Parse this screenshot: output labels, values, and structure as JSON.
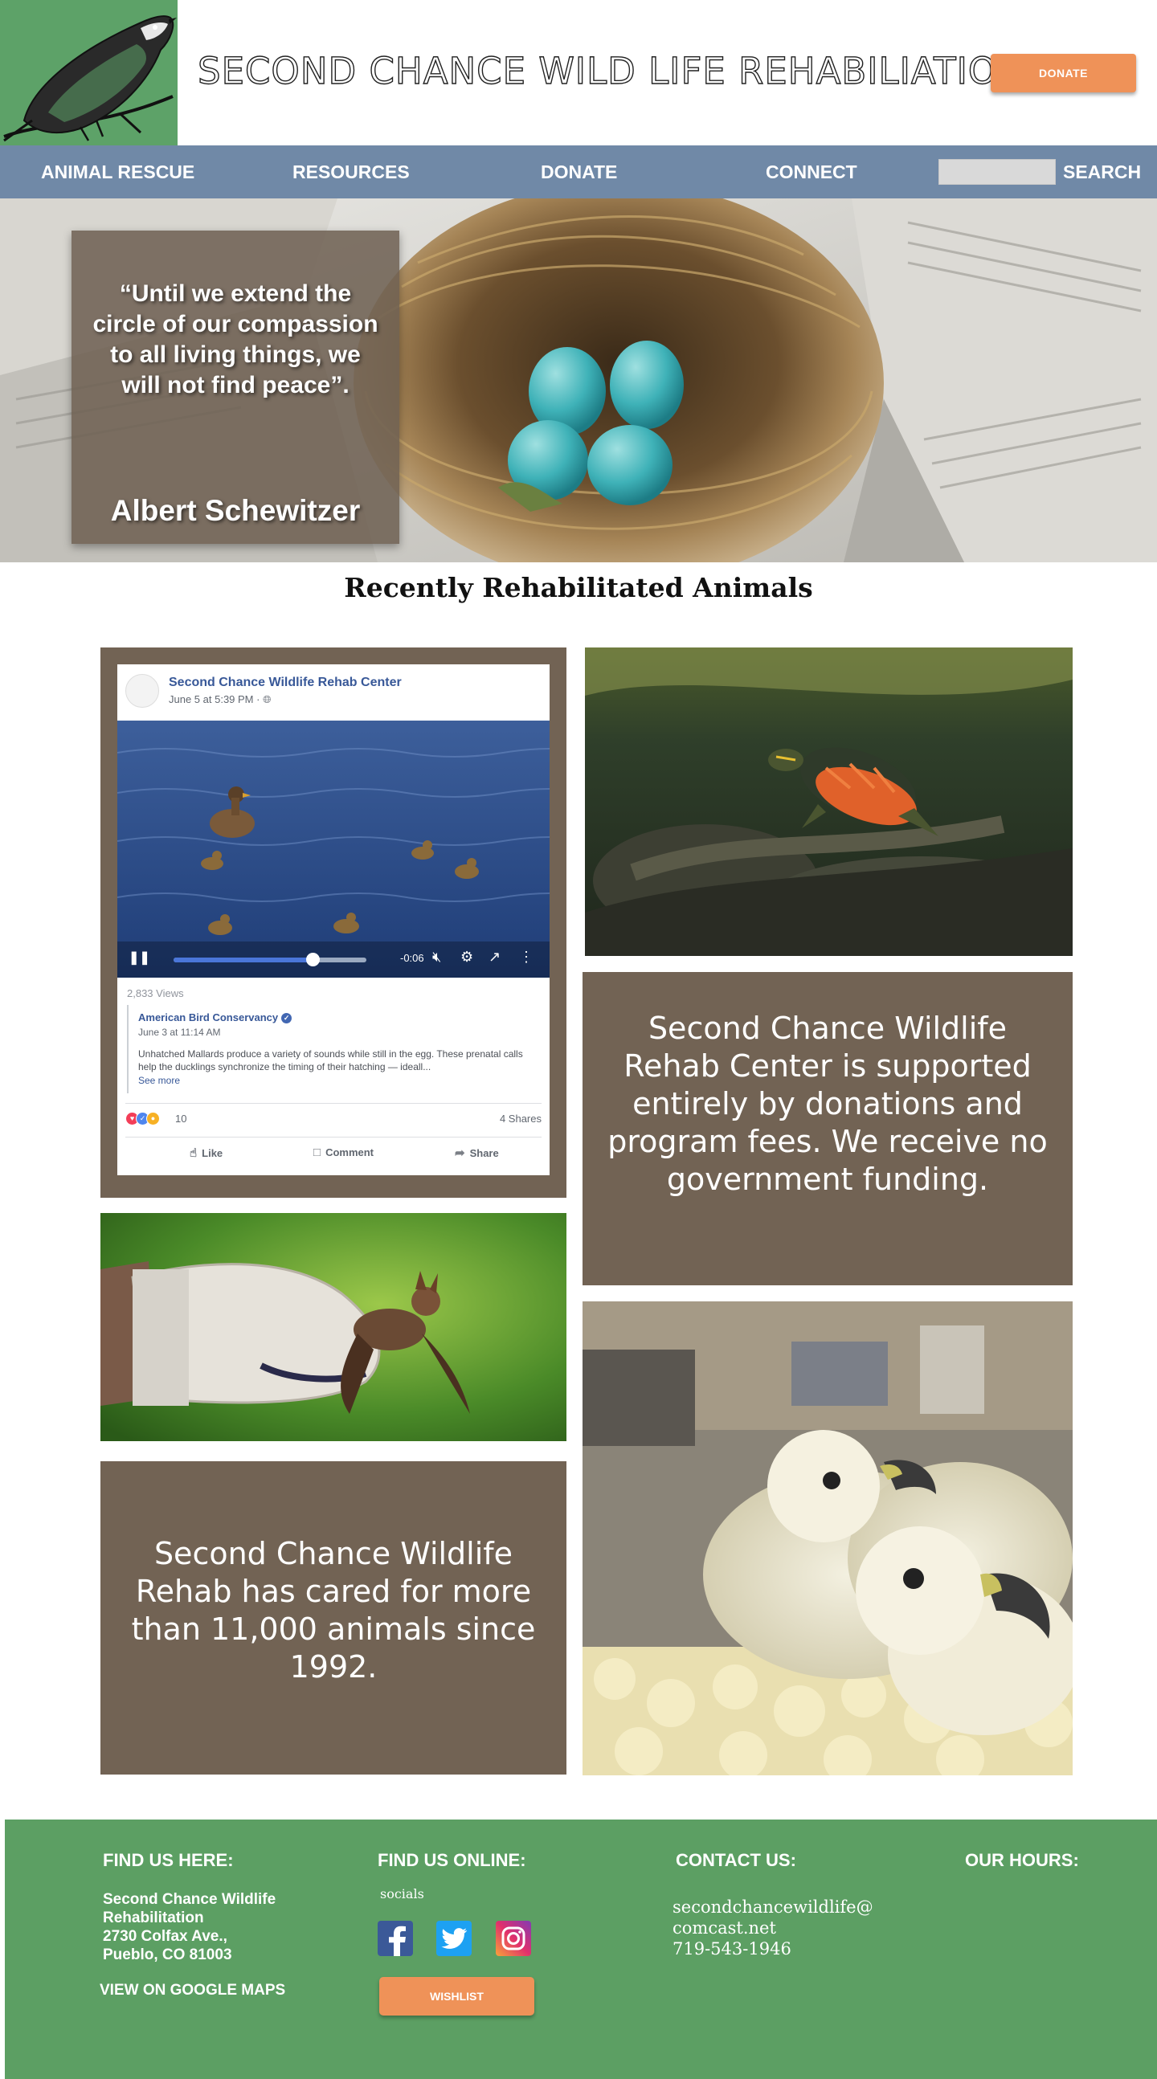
{
  "header": {
    "title": "SECOND CHANCE WILD LIFE REHABILIATION",
    "donate_label": "DONATE",
    "logo_icon": "chickadee-bird-icon"
  },
  "nav": {
    "items": [
      {
        "label": "ANIMAL RESCUE"
      },
      {
        "label": "RESOURCES"
      },
      {
        "label": "DONATE"
      },
      {
        "label": "CONNECT"
      }
    ],
    "search_value": "",
    "search_label": "SEARCH"
  },
  "hero": {
    "quote": "“Until we extend the circle of our compassion to all living things, we will not find peace”.",
    "author": "Albert Schewitzer"
  },
  "section": {
    "title": "Recently Rehabilitated Animals"
  },
  "fb_post": {
    "page_name": "Second Chance Wildlife Rehab Center",
    "date": "June 5 at 5:39 PM · ",
    "time_remaining": "-0:06",
    "progress": 0.72,
    "views": "2,833 Views",
    "quoted_name": "American Bird Conservancy",
    "quoted_date": "June 3 at 11:14 AM",
    "quoted_body": "Unhatched Mallards produce a variety of sounds while still in the egg. These prenatal calls help the ducklings synchronize the timing of their hatching — ideall...",
    "see_more": "See more",
    "reaction_count": "10",
    "shares": "4 Shares",
    "actions": {
      "like": "Like",
      "comment": "Comment",
      "share": "Share"
    }
  },
  "tiles": {
    "support_text": "Second Chance Wildlife Rehab Center is supported entirely by donations and program fees. We receive no government funding.",
    "cared_text": "Second Chance Wildlife Rehab has cared for more than 11,000 animals since 1992."
  },
  "footer": {
    "find_us_here": "FIND US HERE:",
    "address_lines": [
      "Second Chance Wildlife",
      "Rehabilitation",
      "2730 Colfax Ave.,",
      "Pueblo, CO 81003"
    ],
    "maps_label": "VIEW ON GOOGLE MAPS",
    "find_us_online": "FIND US ONLINE:",
    "socials_label": "socials",
    "social_icons": [
      "facebook-icon",
      "twitter-icon",
      "instagram-icon"
    ],
    "wishlist_label": "WISHLIST",
    "contact_us": "CONTACT US:",
    "contact_lines": [
      "secondchancewildlife@",
      "comcast.net",
      "719-543-1946"
    ],
    "our_hours": "OUR HOURS:"
  },
  "colors": {
    "green": "#5da268",
    "nav_blue": "#7089a7",
    "brown": "#726354",
    "orange": "#ef9258"
  }
}
